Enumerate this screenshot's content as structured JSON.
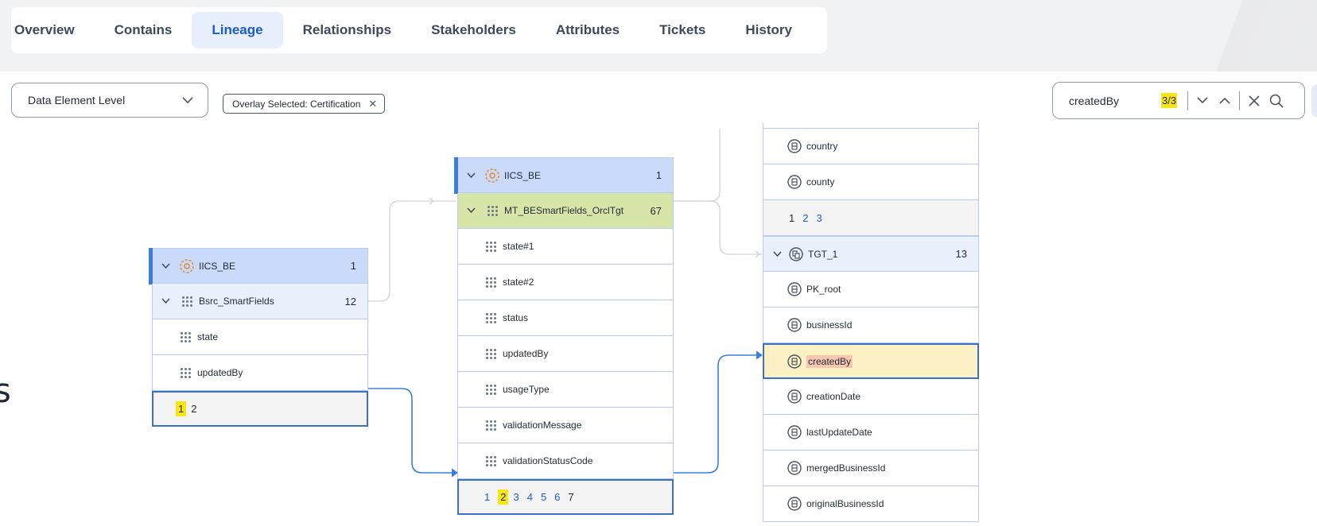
{
  "tabs": [
    {
      "label": "Overview",
      "active": false
    },
    {
      "label": "Contains",
      "active": false
    },
    {
      "label": "Lineage",
      "active": true
    },
    {
      "label": "Relationships",
      "active": false
    },
    {
      "label": "Stakeholders",
      "active": false
    },
    {
      "label": "Attributes",
      "active": false
    },
    {
      "label": "Tickets",
      "active": false
    },
    {
      "label": "History",
      "active": false
    }
  ],
  "toolbar": {
    "level_select": "Data Element Level",
    "overlay_chip": "Overlay Selected: Certification",
    "search_value": "createdBy",
    "search_count": "3/3"
  },
  "canvas": {
    "edge_letter": "s",
    "left_node": {
      "header": {
        "label": "IICS_BE",
        "count": "1"
      },
      "group": {
        "label": "Bsrc_SmartFields",
        "count": "12"
      },
      "rows": [
        "state",
        "updatedBy"
      ],
      "pager": {
        "current": "1",
        "pages": [
          "2"
        ]
      }
    },
    "middle_node": {
      "header": {
        "label": "IICS_BE",
        "count": "1"
      },
      "group": {
        "label": "MT_BESmartFields_OrclTgt",
        "count": "67"
      },
      "rows": [
        "state#1",
        "state#2",
        "status",
        "updatedBy",
        "usageType",
        "validationMessage",
        "validationStatusCode"
      ],
      "pager": {
        "before": [
          "1"
        ],
        "current": "2",
        "after": [
          "3",
          "4",
          "5",
          "6"
        ],
        "last": "7"
      }
    },
    "right_node": {
      "rows_top": [
        "country",
        "county"
      ],
      "pager": {
        "dark": "1",
        "pages": [
          "2",
          "3"
        ]
      },
      "group": {
        "label": "TGT_1",
        "count": "13"
      },
      "rows": [
        "PK_root",
        "businessId",
        "createdBy",
        "creationDate",
        "lastUpdateDate",
        "mergedBusinessId",
        "originalBusinessId"
      ],
      "highlighted": "createdBy"
    }
  },
  "colors": {
    "accent": "#1b5dc7",
    "header_bg": "#c9dafa",
    "group_green": "#d7e6a8",
    "search_highlight": "#f7e514",
    "row_highlight": "#fcf1c4",
    "link": "#3b7ddd"
  }
}
